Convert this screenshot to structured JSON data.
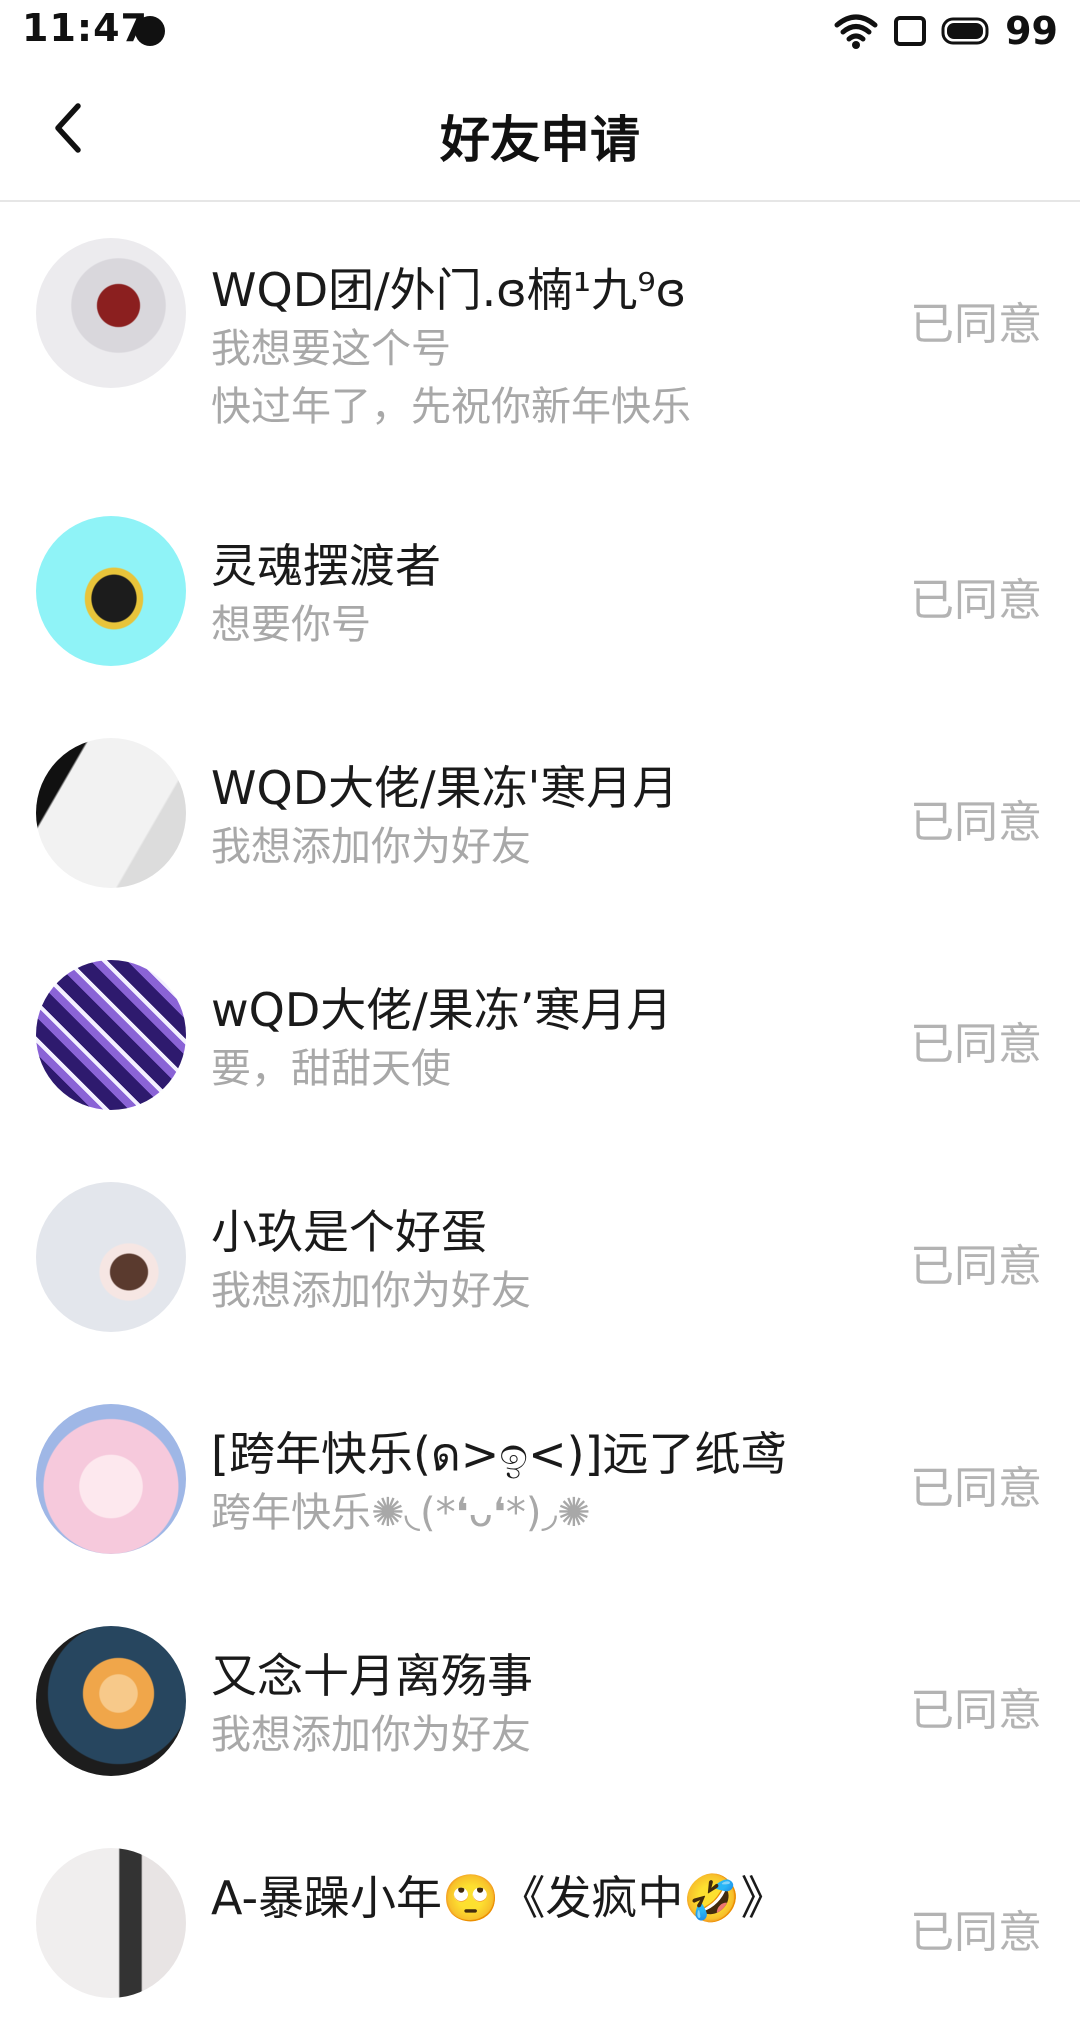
{
  "status_bar": {
    "time": "11:47",
    "battery": "99"
  },
  "header": {
    "title": "好友申请"
  },
  "requests": [
    {
      "name": "WQD团/外门.ɞ楠¹九⁹ɞ",
      "messages": [
        "我想要这个号",
        "快过年了，先祝你新年快乐"
      ],
      "status": "已同意",
      "avatar_colors": [
        "#ecebee",
        "#8b1f1f"
      ]
    },
    {
      "name": "灵魂摆渡者",
      "messages": [
        "想要你号"
      ],
      "status": "已同意",
      "avatar_colors": [
        "#8ff3f7",
        "#1c1c1c"
      ]
    },
    {
      "name": "WQD大佬/果冻'寒月月",
      "messages": [
        "我想添加你为好友"
      ],
      "status": "已同意",
      "avatar_colors": [
        "#f2f2f2",
        "#111111"
      ]
    },
    {
      "name": "wQD大佬/果冻’寒月月",
      "messages": [
        "要，甜甜天使"
      ],
      "status": "已同意",
      "avatar_colors": [
        "#2e1a6e",
        "#8a63d6"
      ]
    },
    {
      "name": "小玖是个好蛋",
      "messages": [
        "我想添加你为好友"
      ],
      "status": "已同意",
      "avatar_colors": [
        "#e3e6ec",
        "#5a3a2e"
      ]
    },
    {
      "name": "[跨年快乐(ด>ඉ<)]远了纸鸢",
      "messages": [
        "跨年快乐✺◟(*❛ᴗ❛*)◞✺"
      ],
      "status": "已同意",
      "avatar_colors": [
        "#f6c9dc",
        "#9fb7e6"
      ]
    },
    {
      "name": "又念十月离殇事",
      "messages": [
        "我想添加你为好友"
      ],
      "status": "已同意",
      "avatar_colors": [
        "#27465f",
        "#f0a64a"
      ]
    },
    {
      "name": "A-暴躁小年🙄《发疯中🤣》",
      "messages": [],
      "status": "已同意",
      "avatar_colors": [
        "#f0eeee",
        "#333333"
      ]
    }
  ]
}
